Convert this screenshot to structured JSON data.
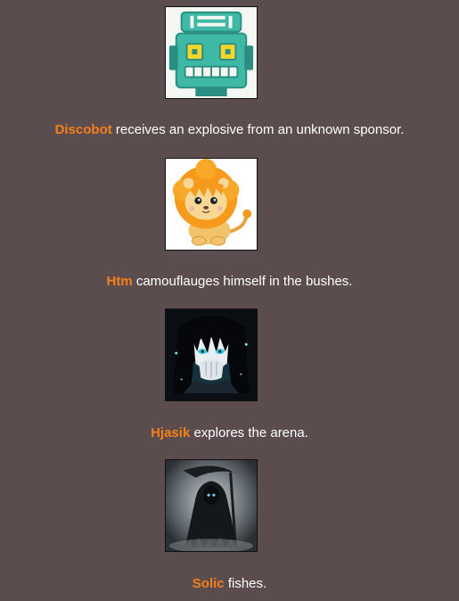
{
  "events": [
    {
      "tribute": "Discobot",
      "action": " receives an explosive from an unknown sponsor.",
      "avatar_icon": "robot-face-icon"
    },
    {
      "tribute": "Htm",
      "action": " camouflauges himself in the bushes.",
      "avatar_icon": "cartoon-lion-icon"
    },
    {
      "tribute": "Hjasik",
      "action": " explores the arena.",
      "avatar_icon": "anime-character-icon"
    },
    {
      "tribute": "Solic",
      "action": " fishes.",
      "avatar_icon": "grim-reaper-icon"
    }
  ],
  "colors": {
    "background": "#5b4d4d",
    "tribute_name": "#f47f1c",
    "text": "#ffffff"
  }
}
